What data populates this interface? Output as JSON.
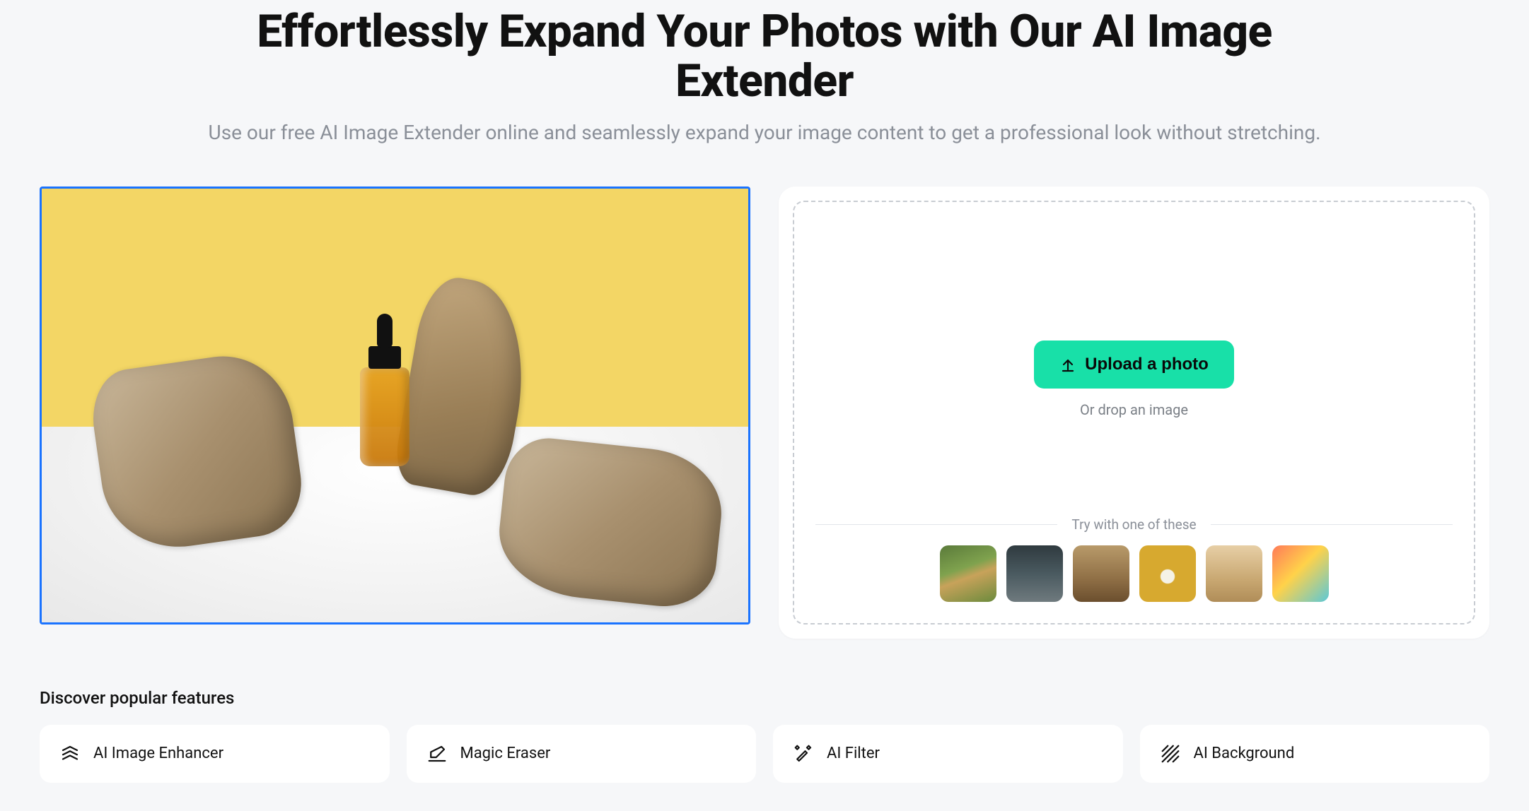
{
  "hero": {
    "title": "Effortlessly Expand Your Photos with Our AI Image Extender",
    "subtitle": "Use our free AI Image Extender online and seamlessly expand your image content to get a professional look without stretching."
  },
  "upload": {
    "button_label": "Upload a photo",
    "drop_hint": "Or drop an image",
    "samples_heading": "Try with one of these",
    "samples": [
      {
        "name": "sample-dog"
      },
      {
        "name": "sample-chair"
      },
      {
        "name": "sample-bottle"
      },
      {
        "name": "sample-flowers"
      },
      {
        "name": "sample-person-desert"
      },
      {
        "name": "sample-illustration"
      }
    ]
  },
  "features_heading": "Discover popular features",
  "features": [
    {
      "icon": "enhancer-icon",
      "label": "AI Image Enhancer"
    },
    {
      "icon": "eraser-icon",
      "label": "Magic Eraser"
    },
    {
      "icon": "filter-icon",
      "label": "AI Filter"
    },
    {
      "icon": "background-icon",
      "label": "AI Background"
    }
  ]
}
